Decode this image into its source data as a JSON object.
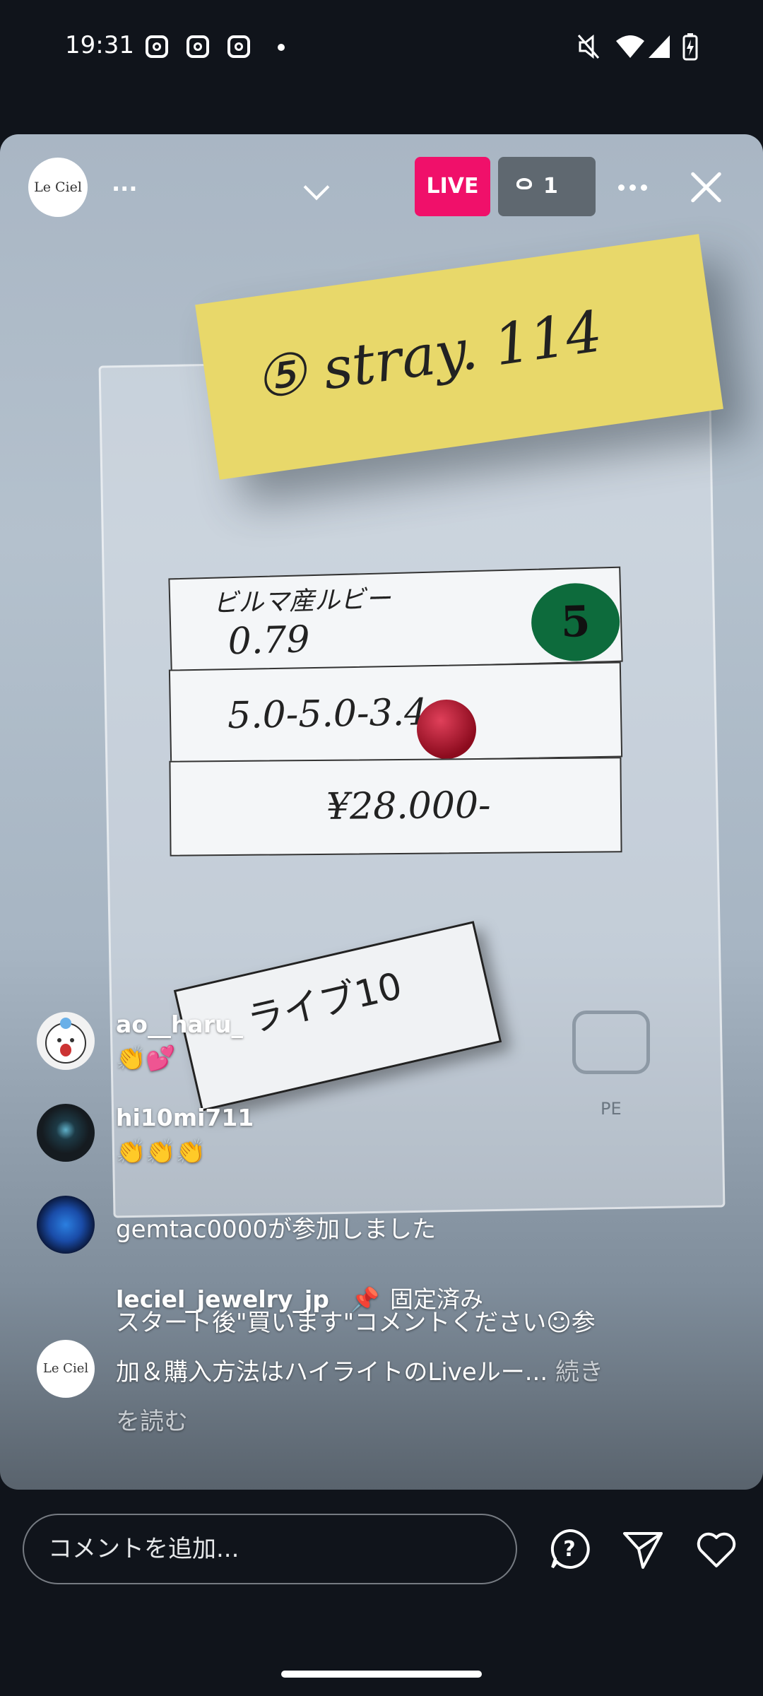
{
  "status_bar": {
    "time": "19:31"
  },
  "live": {
    "host_avatar_text": "Le Ciel",
    "host_name": "...",
    "badge": "LIVE",
    "viewer_count": "1"
  },
  "video": {
    "sticky_note": "⑤ stray. 114",
    "row1_label": "ビルマ産ルビー",
    "row1_value": "0.79",
    "row1_badge": "5",
    "row2_value": "5.0-5.0-3.4",
    "row3_value": "¥28.000-",
    "label_card": "ライブ10",
    "pe_text": "PE"
  },
  "comments": [
    {
      "user": "ao__haru_",
      "text": "👏💕"
    },
    {
      "user": "hi10mi711",
      "text": "👏👏👏"
    },
    {
      "text": "gemtac0000が参加しました"
    }
  ],
  "pinned": {
    "user": "leciel_jewelry_jp",
    "pinned_label": "固定済み",
    "line1": "スタート後\"買います\"コメントください☺参",
    "line2": "加＆購入方法はハイライトのLiveルー...",
    "more": "続き",
    "line3": "を読む",
    "avatar_text": "Le Ciel"
  },
  "bottom_bar": {
    "comment_placeholder": "コメントを追加..."
  }
}
